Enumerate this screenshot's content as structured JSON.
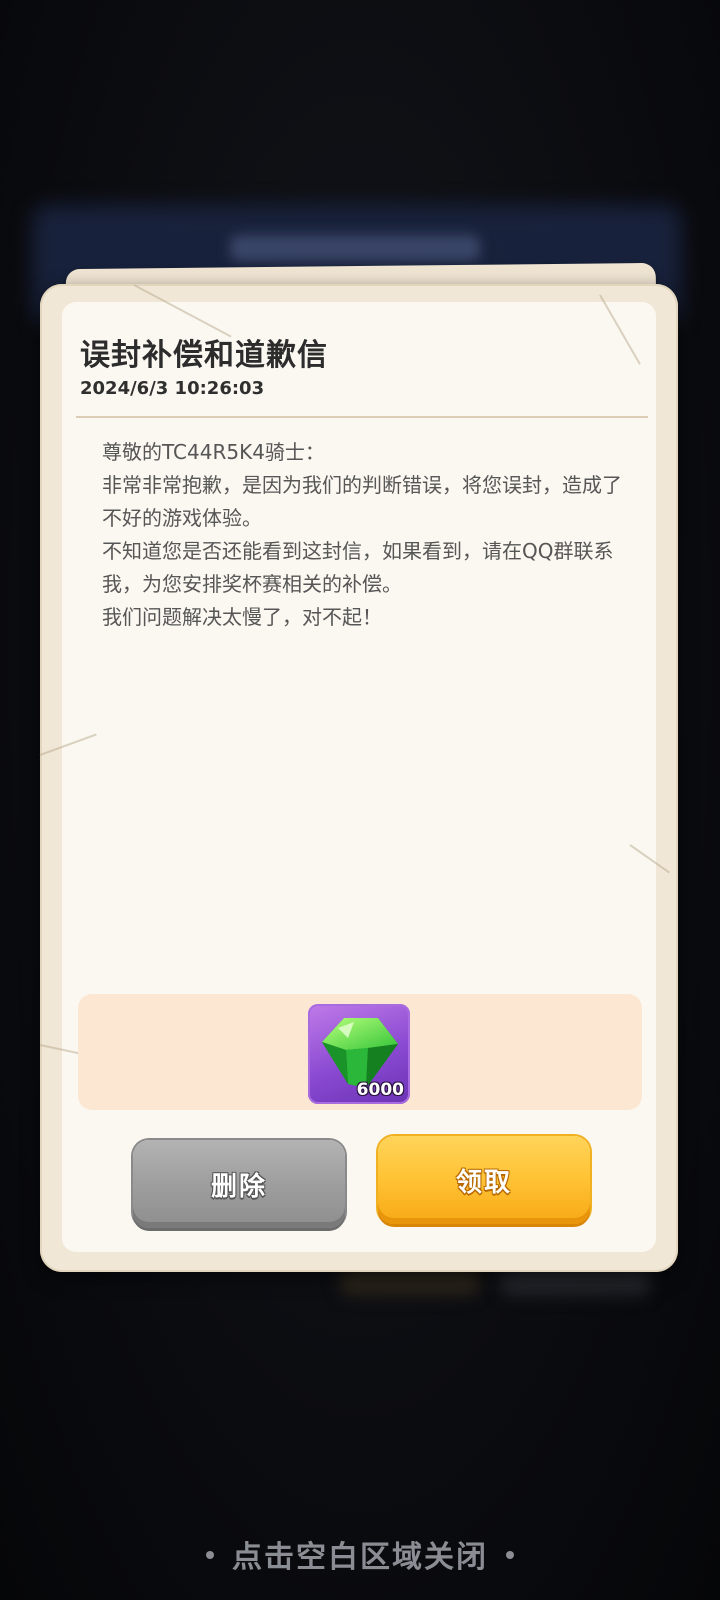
{
  "mail": {
    "title": "误封补偿和道歉信",
    "date": "2024/6/3 10:26:03",
    "body": [
      "尊敬的TC44R5K4骑士：",
      "非常非常抱歉，是因为我们的判断错误，将您误封，造成了不好的游戏体验。",
      "不知道您是否还能看到这封信，如果看到，请在QQ群联系我，为您安排奖杯赛相关的补偿。",
      "我们问题解决太慢了，对不起！"
    ]
  },
  "rewards": [
    {
      "icon": "green-gem-icon",
      "count": "6000"
    }
  ],
  "buttons": {
    "delete_label": "删除",
    "claim_label": "领取"
  },
  "close_hint": "点击空白区域关闭",
  "colors": {
    "claim_button": "#ffc335",
    "delete_button": "#9f9f9f",
    "reward_background": "#fce7d2",
    "item_background": "#8a4ad2"
  }
}
